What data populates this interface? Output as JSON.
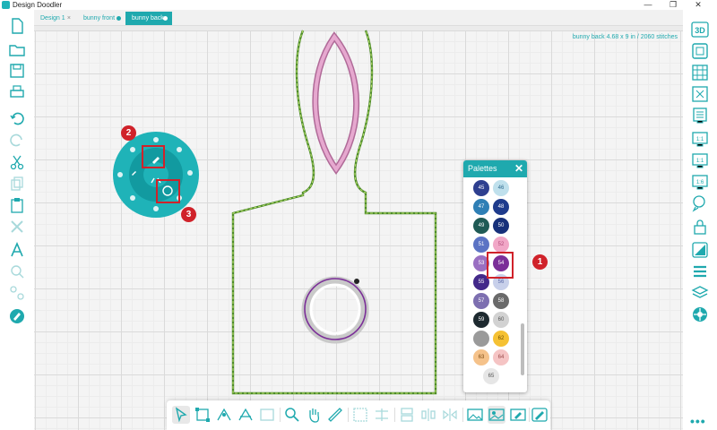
{
  "app": {
    "title": "Design Doodler"
  },
  "window": {
    "minimize": "—",
    "maximize": "❐",
    "close": "✕"
  },
  "tabs": [
    {
      "label": "Design 1",
      "marker": "×",
      "active": false
    },
    {
      "label": "bunny front",
      "marker": "dot",
      "active": false
    },
    {
      "label": "bunny back",
      "marker": "dot",
      "active": true
    }
  ],
  "canvas": {
    "info": "bunny back  4.68 x 9 in / 2060 stitches"
  },
  "palette": {
    "title": "Palettes",
    "close": "✕",
    "swatches": [
      {
        "label": "45",
        "color": "#2e3f8f",
        "text": "#ffffff"
      },
      {
        "label": "46",
        "color": "#bfe0ec",
        "text": "#2e6b8f"
      },
      {
        "label": "47",
        "color": "#2f7fb5",
        "text": "#ffffff"
      },
      {
        "label": "48",
        "color": "#1e3b8c",
        "text": "#ffffff"
      },
      {
        "label": "49",
        "color": "#1f5a55",
        "text": "#ffffff"
      },
      {
        "label": "50",
        "color": "#17307a",
        "text": "#ffffff"
      },
      {
        "label": "51",
        "color": "#5b73c4",
        "text": "#ffffff"
      },
      {
        "label": "52",
        "color": "#f1a7c7",
        "text": "#b24a7a"
      },
      {
        "label": "53",
        "color": "#9a6fc2",
        "text": "#ffffff"
      },
      {
        "label": "54",
        "color": "#7b2f98",
        "text": "#ffffff"
      },
      {
        "label": "55",
        "color": "#43298a",
        "text": "#ffffff"
      },
      {
        "label": "56",
        "color": "#c8d0ea",
        "text": "#5b6aa8"
      },
      {
        "label": "57",
        "color": "#7d6fb0",
        "text": "#ffffff"
      },
      {
        "label": "58",
        "color": "#6a6a6a",
        "text": "#ffffff"
      },
      {
        "label": "59",
        "color": "#1e2a30",
        "text": "#ffffff"
      },
      {
        "label": "60",
        "color": "#d2d2d2",
        "text": "#555555"
      },
      {
        "label": "",
        "color": "#9a9a9a",
        "text": "#ffffff"
      },
      {
        "label": "62",
        "color": "#f5c133",
        "text": "#6b4a00"
      },
      {
        "label": "63",
        "color": "#f5c28a",
        "text": "#7a4a12"
      },
      {
        "label": "64",
        "color": "#f5c4c4",
        "text": "#9a4a4a"
      },
      {
        "label": "65",
        "color": "#e6e6e6",
        "text": "#555555"
      }
    ]
  },
  "callouts": [
    "1",
    "2",
    "3"
  ],
  "colors": {
    "accent": "#1fa9ae",
    "callout": "#d0222a"
  }
}
